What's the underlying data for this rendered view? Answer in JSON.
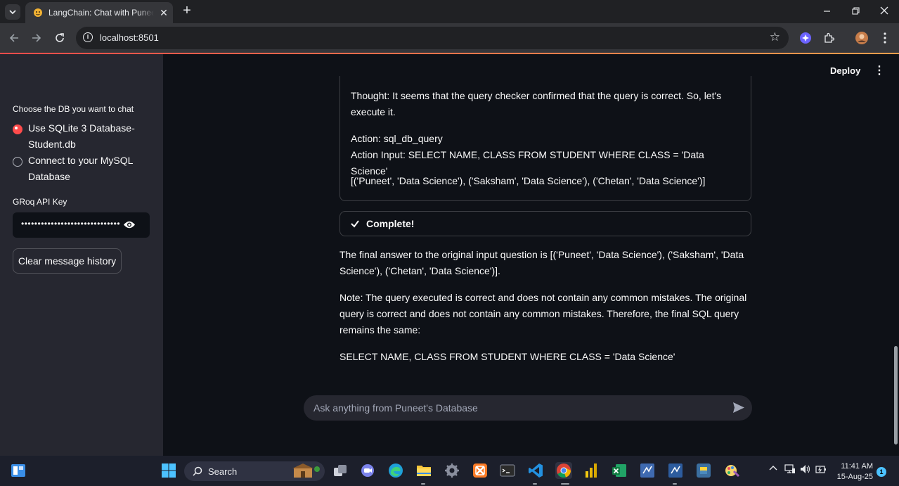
{
  "browser": {
    "tab_title": "LangChain: Chat with Puneet's SQL DB",
    "url": "localhost:8501"
  },
  "sidebar": {
    "db_label": "Choose the DB you want to chat",
    "options": [
      {
        "label": "Use SQLite 3 Database- Student.db",
        "selected": true
      },
      {
        "label": "Connect to your MySQL Database",
        "selected": false
      }
    ],
    "api_key_label": "GRoq API Key",
    "api_key_masked": "••••••••••••••••••••••••••••••",
    "clear_button": "Clear message history"
  },
  "header": {
    "deploy": "Deploy"
  },
  "thought_expander": {
    "thought": "Thought: It seems that the query checker confirmed that the query is correct. So, let's execute it.",
    "action": "Action: sql_db_query",
    "action_input": "Action Input: SELECT NAME, CLASS FROM STUDENT WHERE CLASS = 'Data Science'",
    "observation": "[('Puneet', 'Data Science'), ('Saksham', 'Data Science'), ('Chetan', 'Data Science')]"
  },
  "status": {
    "label": "Complete!"
  },
  "answer": {
    "final": "The final answer to the original input question is [('Puneet', 'Data Science'), ('Saksham', 'Data Science'), ('Chetan', 'Data Science')].",
    "note": "Note: The query executed is correct and does not contain any common mistakes. The original query is correct and does not contain any common mistakes. Therefore, the final SQL query remains the same:",
    "query": "SELECT NAME, CLASS FROM STUDENT WHERE CLASS = 'Data Science'"
  },
  "chat_input": {
    "placeholder": "Ask anything from Puneet's Database"
  },
  "taskbar": {
    "search": "Search",
    "time": "11:41 AM",
    "date": "15-Aug-25",
    "notifications": "1"
  },
  "colors": {
    "accent": "#ff4b4b",
    "app_bg": "#0e1117",
    "sidebar_bg": "#262730"
  }
}
